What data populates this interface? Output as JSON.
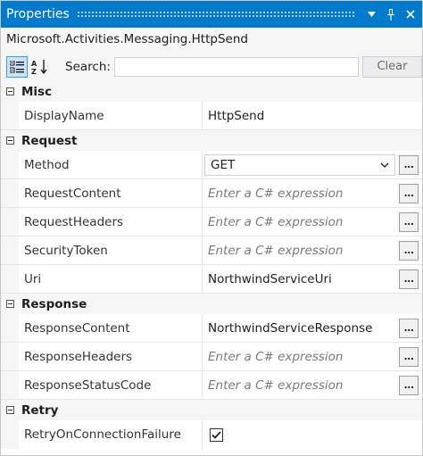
{
  "window": {
    "title": "Properties",
    "object_name": "Microsoft.Activities.Messaging.HttpSend",
    "title_buttons": [
      "dropdown-icon",
      "pin-icon",
      "close-icon"
    ]
  },
  "toolbar": {
    "search_label": "Search:",
    "search_value": "",
    "clear_label": "Clear",
    "icons": [
      "categorized-icon",
      "alphabetical-sort-icon"
    ]
  },
  "categories": [
    {
      "name": "Misc",
      "properties": [
        {
          "name": "DisplayName",
          "value": "HttpSend"
        }
      ]
    },
    {
      "name": "Request",
      "properties": [
        {
          "name": "Method",
          "value": "GET"
        },
        {
          "name": "RequestContent",
          "placeholder": "Enter a C# expression"
        },
        {
          "name": "RequestHeaders",
          "placeholder": "Enter a C# expression"
        },
        {
          "name": "SecurityToken",
          "placeholder": "Enter a C# expression"
        },
        {
          "name": "Uri",
          "value": "NorthwindServiceUri"
        }
      ]
    },
    {
      "name": "Response",
      "properties": [
        {
          "name": "ResponseContent",
          "value": "NorthwindServiceResponse"
        },
        {
          "name": "ResponseHeaders",
          "placeholder": "Enter a C# expression"
        },
        {
          "name": "ResponseStatusCode",
          "placeholder": "Enter a C# expression"
        }
      ]
    },
    {
      "name": "Retry",
      "properties": [
        {
          "name": "RetryOnConnectionFailure",
          "checked": true
        }
      ]
    }
  ],
  "colors": {
    "title_bar": "#007acc",
    "panel_bg": "#f5f5f5",
    "placeholder_text": "#7a7a7a"
  }
}
